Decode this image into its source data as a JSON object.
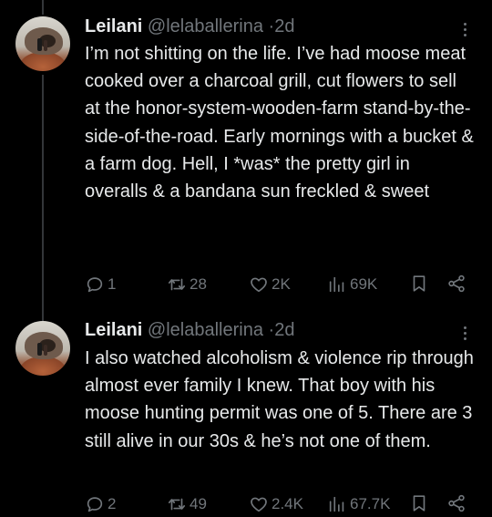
{
  "tweets": [
    {
      "name": "Leilani",
      "handle": "@lelaballerina",
      "separator": "·",
      "time": "2d",
      "text": "I’m not shitting on the life. I’ve had moose meat cooked over a charcoal grill, cut flowers to sell at the honor-system-wooden-farm stand-by-the-side-of-the-road. Early mornings with a bucket & a farm dog. Hell, I *was* the pretty girl in overalls & a bandana sun freckled & sweet",
      "replies": "1",
      "reposts": "28",
      "likes": "2K",
      "views": "69K"
    },
    {
      "name": "Leilani",
      "handle": "@lelaballerina",
      "separator": "·",
      "time": "2d",
      "text": "I also watched alcoholism & violence rip through almost ever family I knew. That boy with his moose hunting permit was one of 5. There are 3 still alive in our 30s & he’s not one of them.",
      "replies": "2",
      "reposts": "49",
      "likes": "2.4K",
      "views": "67.7K"
    }
  ],
  "icons": {
    "reply": "reply-icon",
    "repost": "repost-icon",
    "like": "heart-icon",
    "views": "views-icon",
    "bookmark": "bookmark-icon",
    "share": "share-icon",
    "more": "more-icon"
  }
}
